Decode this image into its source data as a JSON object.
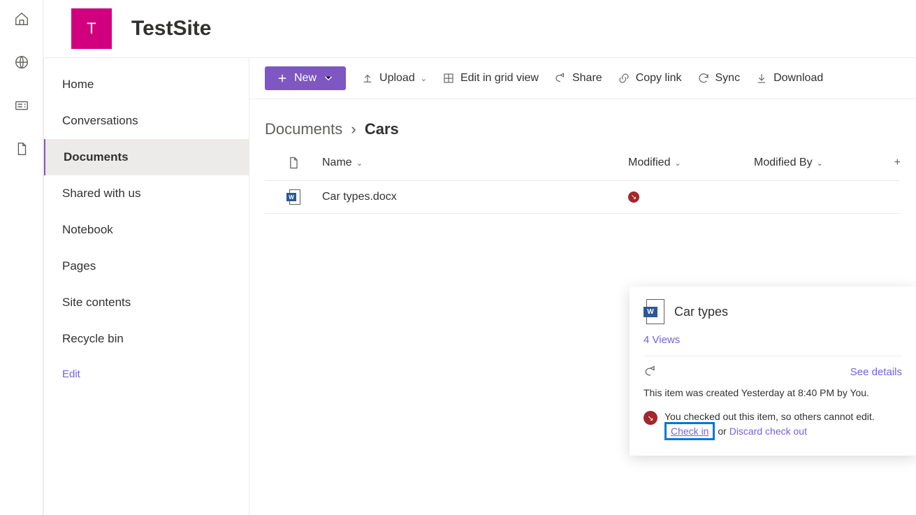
{
  "site": {
    "initial": "T",
    "name": "TestSite"
  },
  "rail": [
    "home-icon",
    "globe-icon",
    "news-icon",
    "file-icon"
  ],
  "nav": {
    "items": [
      "Home",
      "Conversations",
      "Documents",
      "Shared with us",
      "Notebook",
      "Pages",
      "Site contents",
      "Recycle bin"
    ],
    "active_index": 2,
    "edit_label": "Edit"
  },
  "commands": {
    "new_label": "New",
    "upload_label": "Upload",
    "grid_label": "Edit in grid view",
    "share_label": "Share",
    "copylink_label": "Copy link",
    "sync_label": "Sync",
    "download_label": "Download"
  },
  "breadcrumb": {
    "root": "Documents",
    "leaf": "Cars"
  },
  "columns": {
    "name": "Name",
    "modified": "Modified",
    "modified_by": "Modified By"
  },
  "files": [
    {
      "name": "Car types.docx",
      "checked_out": true
    }
  ],
  "card": {
    "title": "Car types",
    "views": "4 Views",
    "see_details": "See details",
    "created_text": "This item was created Yesterday at 8:40 PM by You.",
    "checkout_msg": "You checked out this item, so others cannot edit.",
    "checkin_label": "Check in",
    "or_label": " or ",
    "discard_label": "Discard check out"
  }
}
